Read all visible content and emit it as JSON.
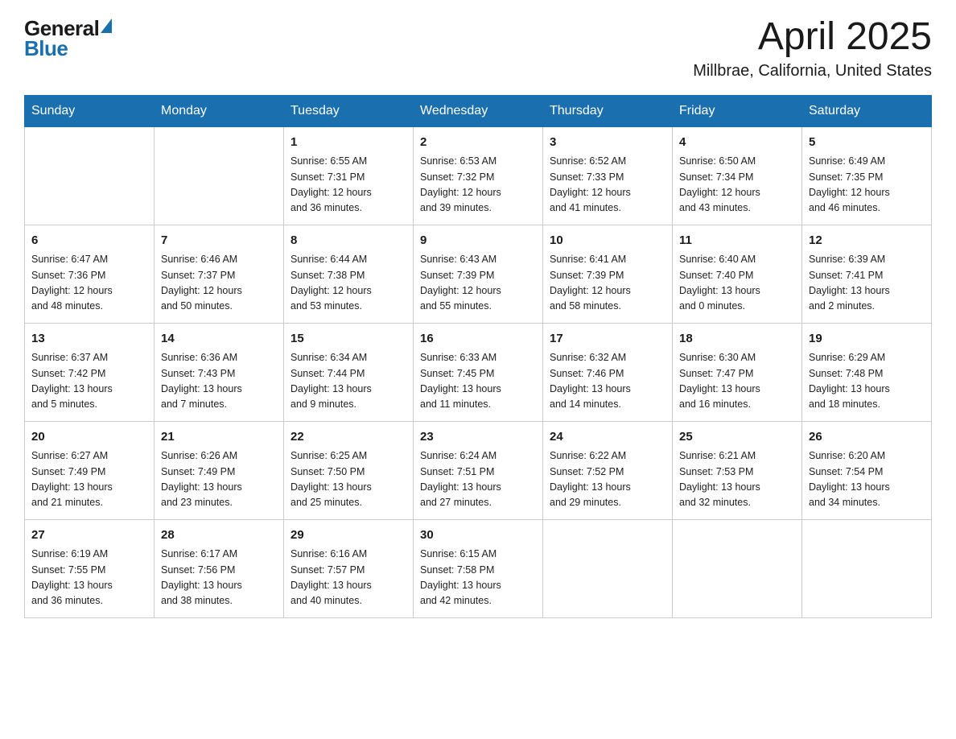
{
  "header": {
    "logo_general": "General",
    "logo_blue": "Blue",
    "month_title": "April 2025",
    "location": "Millbrae, California, United States"
  },
  "weekdays": [
    "Sunday",
    "Monday",
    "Tuesday",
    "Wednesday",
    "Thursday",
    "Friday",
    "Saturday"
  ],
  "weeks": [
    [
      {
        "day": "",
        "info": ""
      },
      {
        "day": "",
        "info": ""
      },
      {
        "day": "1",
        "info": "Sunrise: 6:55 AM\nSunset: 7:31 PM\nDaylight: 12 hours\nand 36 minutes."
      },
      {
        "day": "2",
        "info": "Sunrise: 6:53 AM\nSunset: 7:32 PM\nDaylight: 12 hours\nand 39 minutes."
      },
      {
        "day": "3",
        "info": "Sunrise: 6:52 AM\nSunset: 7:33 PM\nDaylight: 12 hours\nand 41 minutes."
      },
      {
        "day": "4",
        "info": "Sunrise: 6:50 AM\nSunset: 7:34 PM\nDaylight: 12 hours\nand 43 minutes."
      },
      {
        "day": "5",
        "info": "Sunrise: 6:49 AM\nSunset: 7:35 PM\nDaylight: 12 hours\nand 46 minutes."
      }
    ],
    [
      {
        "day": "6",
        "info": "Sunrise: 6:47 AM\nSunset: 7:36 PM\nDaylight: 12 hours\nand 48 minutes."
      },
      {
        "day": "7",
        "info": "Sunrise: 6:46 AM\nSunset: 7:37 PM\nDaylight: 12 hours\nand 50 minutes."
      },
      {
        "day": "8",
        "info": "Sunrise: 6:44 AM\nSunset: 7:38 PM\nDaylight: 12 hours\nand 53 minutes."
      },
      {
        "day": "9",
        "info": "Sunrise: 6:43 AM\nSunset: 7:39 PM\nDaylight: 12 hours\nand 55 minutes."
      },
      {
        "day": "10",
        "info": "Sunrise: 6:41 AM\nSunset: 7:39 PM\nDaylight: 12 hours\nand 58 minutes."
      },
      {
        "day": "11",
        "info": "Sunrise: 6:40 AM\nSunset: 7:40 PM\nDaylight: 13 hours\nand 0 minutes."
      },
      {
        "day": "12",
        "info": "Sunrise: 6:39 AM\nSunset: 7:41 PM\nDaylight: 13 hours\nand 2 minutes."
      }
    ],
    [
      {
        "day": "13",
        "info": "Sunrise: 6:37 AM\nSunset: 7:42 PM\nDaylight: 13 hours\nand 5 minutes."
      },
      {
        "day": "14",
        "info": "Sunrise: 6:36 AM\nSunset: 7:43 PM\nDaylight: 13 hours\nand 7 minutes."
      },
      {
        "day": "15",
        "info": "Sunrise: 6:34 AM\nSunset: 7:44 PM\nDaylight: 13 hours\nand 9 minutes."
      },
      {
        "day": "16",
        "info": "Sunrise: 6:33 AM\nSunset: 7:45 PM\nDaylight: 13 hours\nand 11 minutes."
      },
      {
        "day": "17",
        "info": "Sunrise: 6:32 AM\nSunset: 7:46 PM\nDaylight: 13 hours\nand 14 minutes."
      },
      {
        "day": "18",
        "info": "Sunrise: 6:30 AM\nSunset: 7:47 PM\nDaylight: 13 hours\nand 16 minutes."
      },
      {
        "day": "19",
        "info": "Sunrise: 6:29 AM\nSunset: 7:48 PM\nDaylight: 13 hours\nand 18 minutes."
      }
    ],
    [
      {
        "day": "20",
        "info": "Sunrise: 6:27 AM\nSunset: 7:49 PM\nDaylight: 13 hours\nand 21 minutes."
      },
      {
        "day": "21",
        "info": "Sunrise: 6:26 AM\nSunset: 7:49 PM\nDaylight: 13 hours\nand 23 minutes."
      },
      {
        "day": "22",
        "info": "Sunrise: 6:25 AM\nSunset: 7:50 PM\nDaylight: 13 hours\nand 25 minutes."
      },
      {
        "day": "23",
        "info": "Sunrise: 6:24 AM\nSunset: 7:51 PM\nDaylight: 13 hours\nand 27 minutes."
      },
      {
        "day": "24",
        "info": "Sunrise: 6:22 AM\nSunset: 7:52 PM\nDaylight: 13 hours\nand 29 minutes."
      },
      {
        "day": "25",
        "info": "Sunrise: 6:21 AM\nSunset: 7:53 PM\nDaylight: 13 hours\nand 32 minutes."
      },
      {
        "day": "26",
        "info": "Sunrise: 6:20 AM\nSunset: 7:54 PM\nDaylight: 13 hours\nand 34 minutes."
      }
    ],
    [
      {
        "day": "27",
        "info": "Sunrise: 6:19 AM\nSunset: 7:55 PM\nDaylight: 13 hours\nand 36 minutes."
      },
      {
        "day": "28",
        "info": "Sunrise: 6:17 AM\nSunset: 7:56 PM\nDaylight: 13 hours\nand 38 minutes."
      },
      {
        "day": "29",
        "info": "Sunrise: 6:16 AM\nSunset: 7:57 PM\nDaylight: 13 hours\nand 40 minutes."
      },
      {
        "day": "30",
        "info": "Sunrise: 6:15 AM\nSunset: 7:58 PM\nDaylight: 13 hours\nand 42 minutes."
      },
      {
        "day": "",
        "info": ""
      },
      {
        "day": "",
        "info": ""
      },
      {
        "day": "",
        "info": ""
      }
    ]
  ]
}
